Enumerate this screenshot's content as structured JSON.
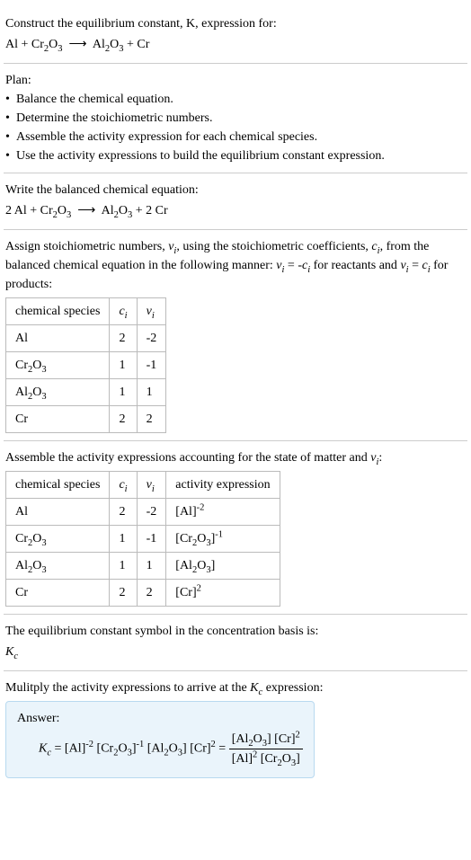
{
  "s1": {
    "line1": "Construct the equilibrium constant, K, expression for:"
  },
  "s2": {
    "heading": "Plan:",
    "b1": "Balance the chemical equation.",
    "b2": "Determine the stoichiometric numbers.",
    "b3": "Assemble the activity expression for each chemical species.",
    "b4": "Use the activity expressions to build the equilibrium constant expression."
  },
  "s3": {
    "line1": "Write the balanced chemical equation:"
  },
  "s4": {
    "line1a": "Assign stoichiometric numbers, ",
    "line1b": ", using the stoichiometric coefficients, ",
    "line1c": ", from the balanced chemical equation in the following manner: ",
    "line1d": " for reactants and ",
    "line1e": " for products:",
    "th1": "chemical species",
    "r1c2": "2",
    "r1c3": "-2",
    "r2c2": "1",
    "r2c3": "-1",
    "r3c2": "1",
    "r3c3": "1",
    "r4c2": "2",
    "r4c3": "2"
  },
  "s5": {
    "line1a": "Assemble the activity expressions accounting for the state of matter and ",
    "line1b": ":",
    "th1": "chemical species",
    "th4": "activity expression",
    "r1c2": "2",
    "r1c3": "-2",
    "r2c2": "1",
    "r2c3": "-1",
    "r3c2": "1",
    "r3c3": "1",
    "r4c2": "2",
    "r4c3": "2"
  },
  "s6": {
    "line1": "The equilibrium constant symbol in the concentration basis is:"
  },
  "s7": {
    "line1a": "Mulitply the activity expressions to arrive at the ",
    "line1b": " expression:",
    "answer_label": "Answer:"
  },
  "sym": {
    "Al": "Al",
    "Cr": "Cr",
    "O": "O",
    "arrow": "⟶",
    "dot": "•",
    "nu": "ν",
    "c": "c",
    "i": "i",
    "K": "K",
    "Kc": "c",
    "eq": " = ",
    "minus": "-",
    "two": "2",
    "three": "3",
    "plus": " + ",
    "space2": "2 ",
    "lbr": "[",
    "rbr": "]",
    "neg1": "-1",
    "neg2": "-2",
    "p1": "1",
    "p2": "2"
  }
}
